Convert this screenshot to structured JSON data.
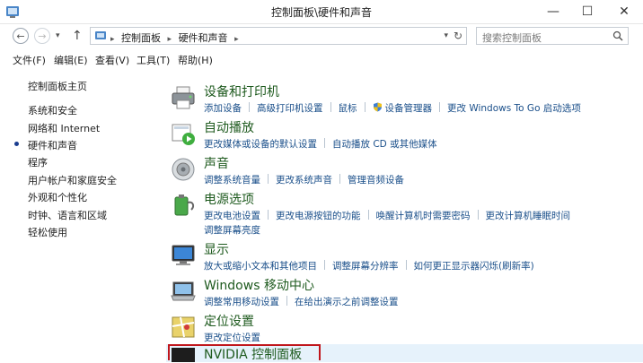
{
  "window": {
    "title": "控制面板\\硬件和声音",
    "minimize": "—",
    "maximize": "☐",
    "close": "✕"
  },
  "nav": {
    "back": "←",
    "forward": "→",
    "history": "▾",
    "up": "↑",
    "crumb_sep": "▸",
    "breadcrumbs": [
      "控制面板",
      "硬件和声音"
    ],
    "dropdown": "▾",
    "refresh": "↻",
    "search_placeholder": "搜索控制面板"
  },
  "menu": [
    "文件(F)",
    "编辑(E)",
    "查看(V)",
    "工具(T)",
    "帮助(H)"
  ],
  "sidebar": {
    "home": "控制面板主页",
    "items": [
      "系统和安全",
      "网络和 Internet",
      "硬件和声音",
      "程序",
      "用户帐户和家庭安全",
      "外观和个性化",
      "时钟、语言和区域",
      "轻松使用"
    ],
    "selected_index": 2
  },
  "categories": [
    {
      "title": "设备和打印机",
      "icon": "printer-icon",
      "links": [
        "添加设备",
        "高级打印机设置",
        "鼠标",
        "设备管理器",
        "更改 Windows To Go 启动选项"
      ],
      "links2": []
    },
    {
      "title": "自动播放",
      "icon": "autoplay-icon",
      "links": [
        "更改媒体或设备的默认设置",
        "自动播放 CD 或其他媒体"
      ],
      "links2": []
    },
    {
      "title": "声音",
      "icon": "speaker-icon",
      "links": [
        "调整系统音量",
        "更改系统声音",
        "管理音频设备"
      ],
      "links2": []
    },
    {
      "title": "电源选项",
      "icon": "power-icon",
      "links": [
        "更改电池设置",
        "更改电源按钮的功能",
        "唤醒计算机时需要密码",
        "更改计算机睡眠时间"
      ],
      "links2": [
        "调整屏幕亮度"
      ]
    },
    {
      "title": "显示",
      "icon": "display-icon",
      "links": [
        "放大或缩小文本和其他项目",
        "调整屏幕分辨率",
        "如何更正显示器闪烁(刷新率)"
      ],
      "links2": []
    },
    {
      "title": "Windows 移动中心",
      "icon": "mobility-icon",
      "links": [
        "调整常用移动设置",
        "在给出演示之前调整设置"
      ],
      "links2": []
    },
    {
      "title": "定位设置",
      "icon": "location-icon",
      "links": [
        "更改定位设置"
      ],
      "links2": []
    }
  ],
  "nvidia": {
    "title": "NVIDIA 控制面板",
    "highlight_color": "#c0161c"
  },
  "colors": {
    "link": "#1a4f8a",
    "heading": "#1e5a1e",
    "highlight_row": "#e6f2fb"
  }
}
